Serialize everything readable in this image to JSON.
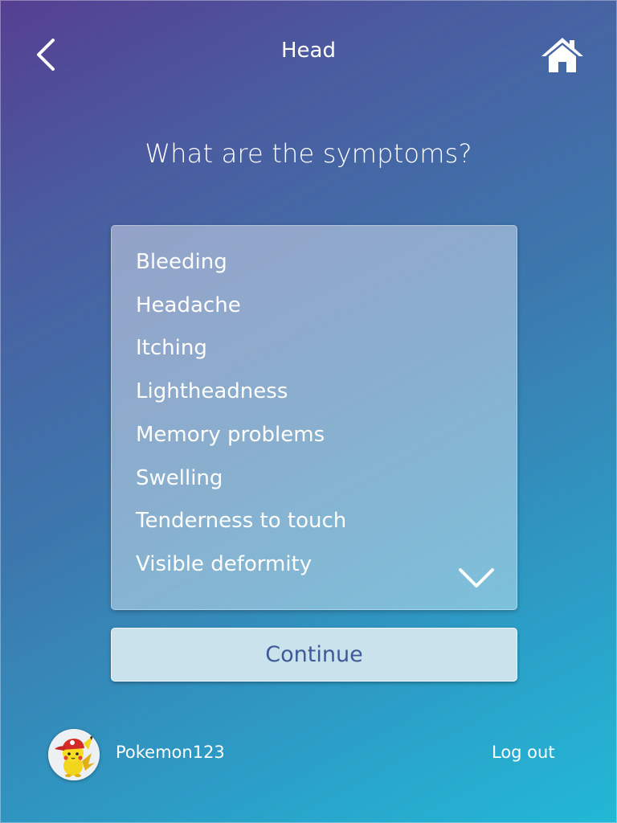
{
  "header": {
    "title": "Head",
    "back_icon": "chevron-left-icon",
    "home_icon": "home-icon"
  },
  "question": "What are the symptoms?",
  "symptoms": [
    "Bleeding",
    "Headache",
    "Itching",
    "Lightheadness",
    "Memory problems",
    "Swelling",
    "Tenderness to touch",
    "Visible deformity"
  ],
  "scroll_icon": "chevron-down-icon",
  "continue_label": "Continue",
  "user": {
    "username": "Pokemon123",
    "avatar": "pikachu-avatar-image"
  },
  "logout_label": "Log out",
  "colors": {
    "gradient_start": "#553f92",
    "gradient_end": "#22b9d6",
    "button_bg": "#c9e2ec",
    "button_text": "#3f5a98"
  }
}
